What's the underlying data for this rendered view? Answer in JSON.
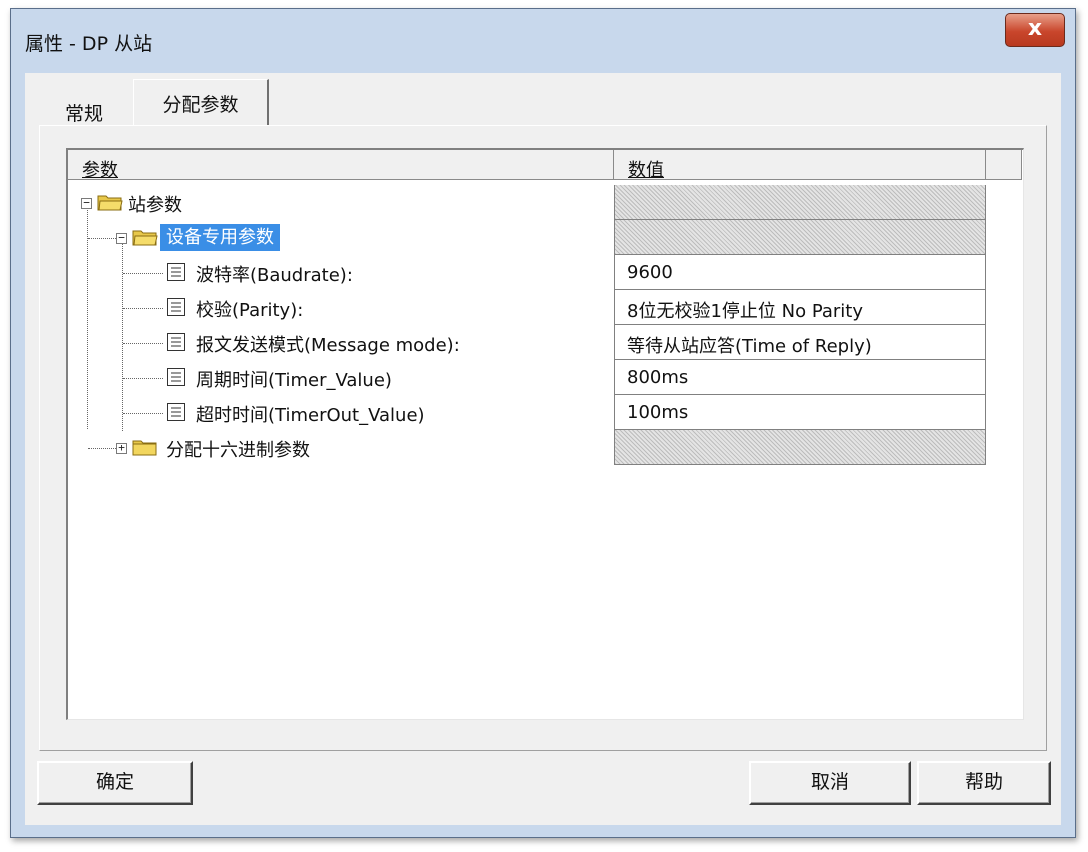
{
  "window": {
    "title": "属性 - DP 从站",
    "close_glyph": "x"
  },
  "tabs": [
    {
      "label": "常规",
      "active": false
    },
    {
      "label": "分配参数",
      "active": true
    }
  ],
  "table": {
    "headers": {
      "param": "参数",
      "value": "数值"
    },
    "rows": [
      {
        "label": "站参数",
        "value": "",
        "expander": "−",
        "icon": "folder-icon"
      },
      {
        "label": "设备专用参数",
        "value": "",
        "expander": "−",
        "icon": "folder-open-icon",
        "selected": true
      },
      {
        "label": "波特率(Baudrate):",
        "value": "9600",
        "icon": "document-icon"
      },
      {
        "label": "校验(Parity):",
        "value": "8位无校验1停止位 No Parity",
        "icon": "document-icon"
      },
      {
        "label": "报文发送模式(Message mode):",
        "value": "等待从站应答(Time of Reply)",
        "icon": "document-icon"
      },
      {
        "label": "周期时间(Timer_Value)",
        "value": "800ms",
        "icon": "document-icon"
      },
      {
        "label": "超时时间(TimerOut_Value)",
        "value": "100ms",
        "icon": "document-icon"
      },
      {
        "label": "分配十六进制参数",
        "value": "",
        "expander": "+",
        "icon": "folder-icon"
      }
    ]
  },
  "buttons": {
    "ok": "确定",
    "cancel": "取消",
    "help": "帮助"
  },
  "colors": {
    "selection": "#3a8ee6",
    "folder": "#e8c84a",
    "close_button": "#c9462c"
  }
}
